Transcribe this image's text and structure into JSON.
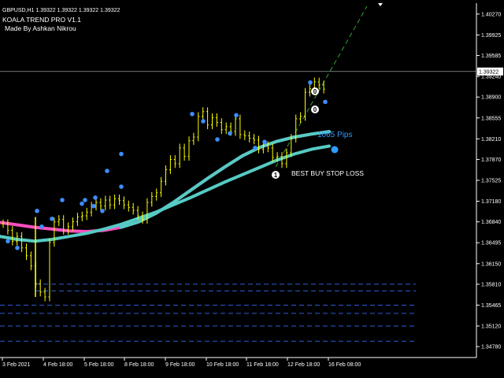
{
  "header": {
    "symbol_line": "GBPUSD,H1  1.39322 1.39322 1.39322 1.39322",
    "title": "KOALA TREND PRO V1.1",
    "author": "Made By Ashkan Nikrou"
  },
  "colors": {
    "background": "#000000",
    "candles": "#ffff00",
    "slow_ma": "#55cbc4",
    "ribbon_ma": "#ff4fc1",
    "dots": "#3f8cff",
    "stop_lines": "#2f5bd6",
    "projection": "#2ea52e",
    "pips_text": "#2f9bff"
  },
  "price_axis": {
    "ticks": [
      "1.40270",
      "1.39925",
      "1.39585",
      "1.39240",
      "1.38900",
      "1.38555",
      "1.38210",
      "1.37870",
      "1.37525",
      "1.37180",
      "1.36840",
      "1.36495",
      "1.36150",
      "1.35810",
      "1.35465",
      "1.35120",
      "1.34780"
    ],
    "current_price": "1.39322",
    "min": 1.346,
    "max": 1.4045
  },
  "time_axis": {
    "labels": [
      "3 Feb 2021",
      "4 Feb 18:00",
      "5 Feb 18:00",
      "8 Feb 18:00",
      "9 Feb 18:00",
      "10 Feb 18:00",
      "11 Feb 18:00",
      "12 Feb 18:00",
      "16 Feb 08:00"
    ]
  },
  "annotations": {
    "stop_loss_label": "BEST BUY STOP LOSS",
    "pips_label": "1065 Pips",
    "signal_marker_1": "1",
    "signal_marker_0a": "0",
    "signal_marker_0b": "0"
  },
  "chart_data": {
    "type": "line",
    "series": [
      {
        "kind": "price",
        "values": [
          1.3681,
          1.367,
          1.3652,
          1.366,
          1.3641,
          1.3628,
          1.3611,
          1.3582,
          1.3568,
          1.356,
          1.365,
          1.3684,
          1.3688,
          1.367,
          1.3676,
          1.3684,
          1.3692,
          1.3694,
          1.37,
          1.371,
          1.3716,
          1.371,
          1.372,
          1.3712,
          1.3722,
          1.3719,
          1.3712,
          1.3708,
          1.3703,
          1.3694,
          1.3688,
          1.3716,
          1.3726,
          1.3732,
          1.3751,
          1.377,
          1.3787,
          1.378,
          1.3806,
          1.3792,
          1.3818,
          1.3824,
          1.3858,
          1.3866,
          1.3844,
          1.3856,
          1.3848,
          1.3836,
          1.3841,
          1.3833,
          1.3854,
          1.3828,
          1.3826,
          1.3822,
          1.3819,
          1.3804,
          1.381,
          1.3806,
          1.379,
          1.3792,
          1.378,
          1.3798,
          1.3822,
          1.3854,
          1.3858,
          1.3898,
          1.3904,
          1.3915,
          1.391,
          1.3903
        ]
      },
      {
        "kind": "slow_ma",
        "values": [
          1.366,
          1.3655,
          1.3652,
          1.3655,
          1.366,
          1.3665,
          1.3672,
          1.368,
          1.369,
          1.37,
          1.3712,
          1.3724,
          1.3737,
          1.375,
          1.3762,
          1.3774,
          1.3786,
          1.3796,
          1.3804,
          1.3809
        ]
      },
      {
        "kind": "ribbon_ma",
        "values": [
          1.3683,
          1.3679,
          1.3675,
          1.3672,
          1.3669,
          1.3668,
          1.367,
          1.3675,
          1.3684,
          1.3698,
          1.3716,
          1.3736,
          1.3756,
          1.3775,
          1.3793,
          1.3807,
          1.3817,
          1.3824,
          1.3829,
          1.3833
        ]
      }
    ],
    "swing_dots": [
      1.3652,
      1.3641,
      1.3702,
      1.3676,
      1.3689,
      1.372,
      1.3714,
      1.372,
      1.371,
      1.3724,
      1.3702,
      1.3768,
      1.3742,
      1.3796,
      1.3862,
      1.385,
      1.382,
      1.383,
      1.386,
      1.3806,
      1.3816,
      1.3914,
      1.3882
    ],
    "stop_lines": [
      1.3581,
      1.357,
      1.35465,
      1.3533,
      1.3512,
      1.3487
    ],
    "current_price_line": 1.39322
  }
}
